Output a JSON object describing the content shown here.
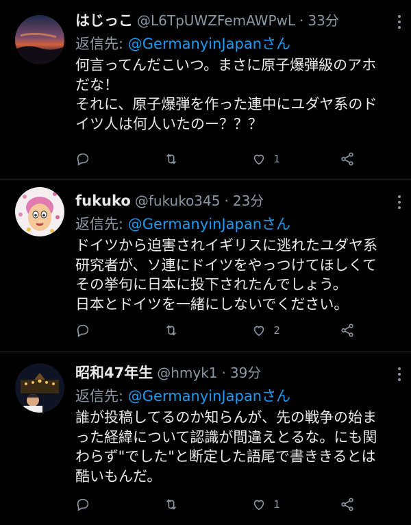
{
  "reply_prefix": "返信先: ",
  "tweets": [
    {
      "name": "はじっこ",
      "handle": "@L6TpUWZFemAWPwL",
      "separator": "·",
      "time": "33分",
      "mention": "@GermanyinJapan",
      "mention_suffix": "さん",
      "lines": [
        "何言ってんだこいつ。まさに原子爆弾級のアホ",
        "だな！",
        "それに、原子爆弾を作った連中にユダヤ系のド",
        "イツ人は何人いたのー？？？"
      ],
      "reply_count": "",
      "retweet_count": "",
      "like_count": "1"
    },
    {
      "name": "fukuko",
      "handle": "@fukuko345",
      "separator": "·",
      "time": "23分",
      "mention": "@GermanyinJapan",
      "mention_suffix": "さん",
      "lines": [
        "ドイツから迫害されイギリスに逃れたユダヤ系",
        "研究者が、ソ連にドイツをやっつけてほしくて",
        "その挙句に日本に投下されたんでしょう。",
        "日本とドイツを一緒にしないでください。"
      ],
      "reply_count": "",
      "retweet_count": "",
      "like_count": "2"
    },
    {
      "name": "昭和47年生",
      "handle": "@hmyk1",
      "separator": "·",
      "time": "39分",
      "mention": "@GermanyinJapan",
      "mention_suffix": "さん",
      "lines": [
        "誰が投稿してるのか知らんが、先の戦争の始ま",
        "った経緯について認識が間違えとるな。にも関",
        "わらず\"でした\"と断定した語尾で書ききるとは",
        "酷いもんだ。"
      ],
      "reply_count": "",
      "retweet_count": "",
      "like_count": "1"
    }
  ],
  "icons": {
    "reply": "reply-icon",
    "retweet": "retweet-icon",
    "like": "heart-icon",
    "share": "share-icon",
    "more": "more-icon"
  },
  "colors": {
    "background": "#000000",
    "text": "#e7e9ea",
    "secondary": "#8b98a5",
    "mention": "#1d9bf0",
    "divider": "#2f3336"
  }
}
